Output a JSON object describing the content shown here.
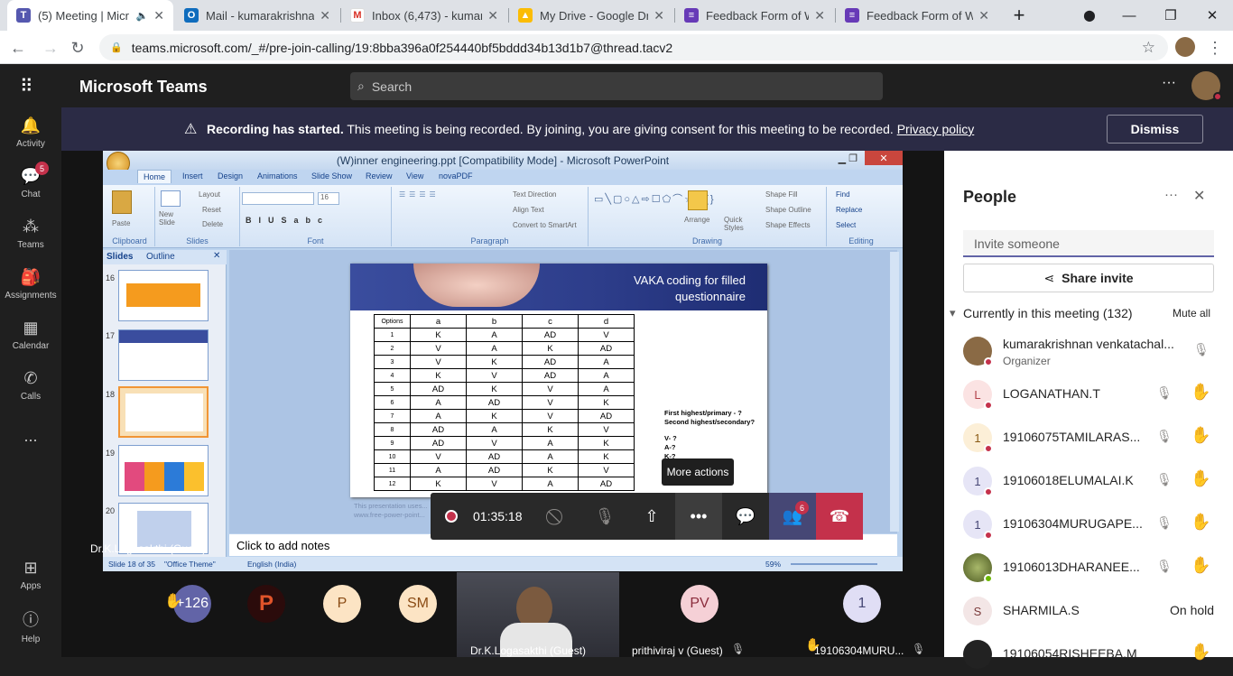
{
  "browser": {
    "tabs": [
      {
        "title": "(5) Meeting | Micr",
        "icon": "teams-icon",
        "active": true
      },
      {
        "title": "Mail - kumarakrishnan",
        "icon": "outlook-icon"
      },
      {
        "title": "Inbox (6,473) - kumar",
        "icon": "gmail-icon"
      },
      {
        "title": "My Drive - Google Dri",
        "icon": "drive-icon"
      },
      {
        "title": "Feedback Form of We",
        "icon": "forms-icon"
      },
      {
        "title": "Feedback Form of Wo",
        "icon": "forms-icon"
      }
    ],
    "url": "teams.microsoft.com/_#/pre-join-calling/19:8bba396a0f254440bf5bddd34b13d1b7@thread.tacv2"
  },
  "teams": {
    "app_title": "Microsoft Teams",
    "search_placeholder": "Search",
    "rail": [
      {
        "label": "Activity",
        "icon": "bell-icon"
      },
      {
        "label": "Chat",
        "icon": "chat-icon",
        "badge": "5"
      },
      {
        "label": "Teams",
        "icon": "teams-icon"
      },
      {
        "label": "Assignments",
        "icon": "backpack-icon"
      },
      {
        "label": "Calendar",
        "icon": "calendar-icon"
      },
      {
        "label": "Calls",
        "icon": "phone-icon"
      },
      {
        "label": "...",
        "icon": "more-icon"
      },
      {
        "label": "Apps",
        "icon": "apps-icon"
      },
      {
        "label": "Help",
        "icon": "help-icon"
      }
    ]
  },
  "banner": {
    "bold": "Recording has started.",
    "text": "This meeting is being recorded. By joining, you are giving consent for this meeting to be recorded.",
    "link": "Privacy policy",
    "dismiss": "Dismiss"
  },
  "ppt": {
    "title": "(W)inner engineering.ppt [Compatibility Mode] - Microsoft PowerPoint",
    "ribbon_tabs": [
      "Home",
      "Insert",
      "Design",
      "Animations",
      "Slide Show",
      "Review",
      "View",
      "novaPDF"
    ],
    "groups": [
      "Clipboard",
      "Slides",
      "Font",
      "Paragraph",
      "Drawing",
      "Editing"
    ],
    "buttons": {
      "paste": "Paste",
      "new_slide": "New Slide",
      "layout": "Layout",
      "reset": "Reset",
      "delete": "Delete",
      "text_direction": "Text Direction",
      "align_text": "Align Text",
      "convert": "Convert to SmartArt",
      "arrange": "Arrange",
      "quick_styles": "Quick Styles",
      "shape_fill": "Shape Fill",
      "shape_outline": "Shape Outline",
      "shape_effects": "Shape Effects",
      "find": "Find",
      "replace": "Replace",
      "select": "Select",
      "font_size": "16"
    },
    "pane_tabs": [
      "Slides",
      "Outline"
    ],
    "thumb_numbers": [
      "16",
      "17",
      "18",
      "19",
      "20"
    ],
    "slide_title_1": "VAKA coding for filled",
    "slide_title_2": "questionnaire",
    "table_header": [
      "Options",
      "a",
      "b",
      "c",
      "d"
    ],
    "table_rows": [
      [
        "1",
        "K",
        "A",
        "AD",
        "V"
      ],
      [
        "2",
        "V",
        "A",
        "K",
        "AD"
      ],
      [
        "3",
        "V",
        "K",
        "AD",
        "A"
      ],
      [
        "4",
        "K",
        "V",
        "AD",
        "A"
      ],
      [
        "5",
        "AD",
        "K",
        "V",
        "A"
      ],
      [
        "6",
        "A",
        "AD",
        "V",
        "K"
      ],
      [
        "7",
        "A",
        "K",
        "V",
        "AD"
      ],
      [
        "8",
        "AD",
        "A",
        "K",
        "V"
      ],
      [
        "9",
        "AD",
        "V",
        "A",
        "K"
      ],
      [
        "10",
        "V",
        "AD",
        "A",
        "K"
      ],
      [
        "11",
        "A",
        "AD",
        "K",
        "V"
      ],
      [
        "12",
        "K",
        "V",
        "A",
        "AD"
      ]
    ],
    "side_text": [
      "First highest/primary - ?",
      "Second highest/secondary?",
      "V- ?",
      "A-?",
      "K-?"
    ],
    "footer_text": "This presentation uses...",
    "footer_url": "www.free-power-point...",
    "notes": "Click to add notes",
    "status": {
      "slide": "Slide 18 of 35",
      "theme": "\"Office Theme\"",
      "lang": "English (India)",
      "zoom": "59%"
    }
  },
  "presenter_label": "Dr.K.Logasakthi (Guest)",
  "controls": {
    "timer": "01:35:18",
    "tooltip": "More actions",
    "participants_badge": "6"
  },
  "gallery": [
    {
      "label": "+126",
      "color": "#6264a7"
    },
    {
      "label": "P",
      "color": "#2b0b0b"
    },
    {
      "label": "P",
      "color": "#fce4c4"
    },
    {
      "label": "SM",
      "color": "#fce4c4"
    },
    {
      "label": "PV",
      "color": "#f5d0d6"
    },
    {
      "label": "1",
      "color": "#e0def5"
    }
  ],
  "gallery_names": [
    "Dr.K.Logasakthi (Guest)",
    "prithiviraj v (Guest)",
    "19106304MURU..."
  ],
  "people": {
    "title": "People",
    "invite_placeholder": "Invite someone",
    "share_invite": "Share invite",
    "section": "Currently in this meeting (132)",
    "mute_all": "Mute all",
    "list": [
      {
        "name": "kumarakrishnan venkatachal...",
        "role": "Organizer",
        "initial": "",
        "color": "#8a6a45",
        "hand": false
      },
      {
        "name": "LOGANATHAN.T",
        "initial": "L",
        "color": "#fbe3e3",
        "hand": true
      },
      {
        "name": "19106075TAMILARAS...",
        "initial": "1",
        "color": "#fcefd7",
        "hand": true
      },
      {
        "name": "19106018ELUMALAI.K",
        "initial": "1",
        "color": "#e6e5f6",
        "hand": true
      },
      {
        "name": "19106304MURUGAPE...",
        "initial": "1",
        "color": "#e6e5f6",
        "hand": true
      },
      {
        "name": "19106013DHARANEE...",
        "initial": "",
        "color": "#6b7a3a",
        "hand": true
      },
      {
        "name": "SHARMILA.S",
        "initial": "S",
        "color": "#f3e6e6",
        "hand": false,
        "status": "On hold"
      },
      {
        "name": "19106054RISHEEBA.M",
        "initial": "",
        "color": "#222",
        "hand": true
      }
    ]
  }
}
